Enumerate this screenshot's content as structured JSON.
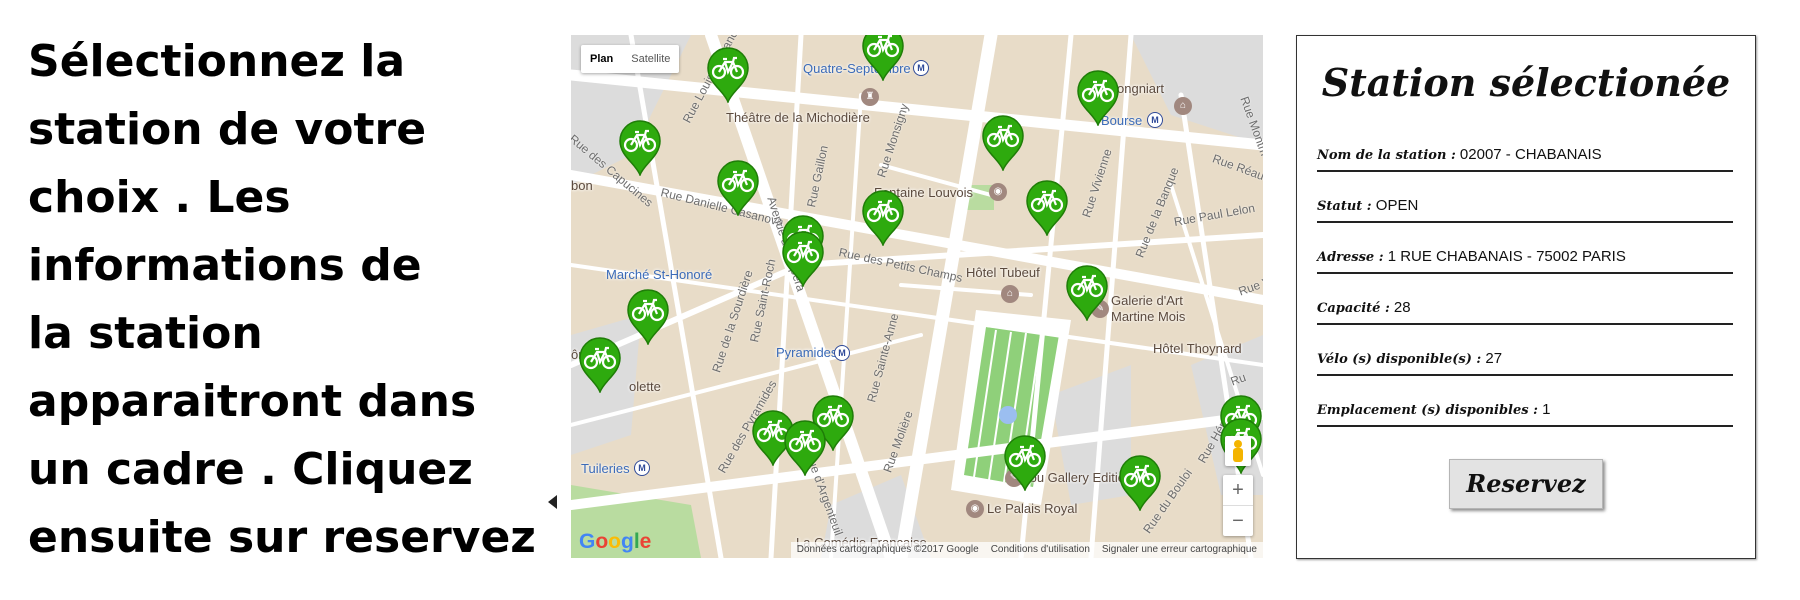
{
  "instructions": {
    "lines": [
      "Sélectionnez la",
      "station de votre",
      "choix . Les",
      "informations de",
      "la station",
      "apparaitront dans",
      "un cadre . Cliquez",
      "ensuite sur reservez"
    ]
  },
  "map": {
    "toggle": {
      "plan": "Plan",
      "satellite": "Satellite"
    },
    "places": {
      "quatre_septembre": "Quatre-Septembre",
      "theatre": "Théâtre de la Michodière",
      "bourse": "Bourse",
      "brongniart": "is Brongniart",
      "fontaine": "Fontaine Louvois",
      "marche": "Marché St-Honoré",
      "hotel_tubeuf": "Hôtel Tubeuf",
      "galerie": "Galerie d'Art",
      "martine": "Martine Mois",
      "thoynard": "Hôtel Thoynard",
      "pyramides": "Pyramides",
      "tuileries": "Tuileries",
      "olette": "olette",
      "ome": "ôme",
      "bon": "bon",
      "ibu": "Ibu Gallery Edition",
      "palais": "Le Palais Royal",
      "comedie": "La Comédie Française"
    },
    "streets": {
      "capucines": "Rue des Capucines",
      "louis_grand": "Rue Louis le Grand",
      "danielle": "Rue Danielle Casanova",
      "gaillon": "Rue Gaillon",
      "monsigny": "Rue Monsigny",
      "opera": "Avenue de l'Opéra",
      "petits_champs": "Rue des Petits Champs",
      "saint_roch": "Rue Saint-Roch",
      "sourdiere": "Rue de la Sourdière",
      "sainte_anne": "Rue Sainte-Anne",
      "pyramides": "Rue des Pyramides",
      "argenteuil": "Rue d'Argenteuil",
      "moliere": "Rue Molière",
      "vivienne": "Rue Vivienne",
      "banque": "Rue de la Banque",
      "paul_lelong": "Rue Paul Lelon",
      "reaumur": "Rue Réau",
      "herold": "Rue Hérold",
      "bouloi": "Rue du Bouloi",
      "montmartre": "Rue Montm",
      "vivienne2": "Rue V",
      "ru": "Ru"
    },
    "metro_letter": "M",
    "google": [
      "G",
      "o",
      "o",
      "g",
      "l",
      "e"
    ],
    "footer": [
      "Données cartographiques ©2017 Google",
      "Conditions d'utilisation",
      "Signaler une erreur cartographique"
    ],
    "zoom_in": "+",
    "zoom_out": "−",
    "marker_color": "#2eaa0e"
  },
  "panel": {
    "title": "Station sélectionée",
    "fields": [
      {
        "label": "Nom de la station :",
        "value": "02007 - CHABANAIS"
      },
      {
        "label": "Statut :",
        "value": "OPEN"
      },
      {
        "label": "Adresse :",
        "value": "1 RUE CHABANAIS - 75002 PARIS"
      },
      {
        "label": "Capacité :",
        "value": "28"
      },
      {
        "label": "Vélo (s) disponible(s) :",
        "value": "27"
      },
      {
        "label": "Emplacement (s) disponibles :",
        "value": "1"
      }
    ],
    "button": "Reservez"
  }
}
